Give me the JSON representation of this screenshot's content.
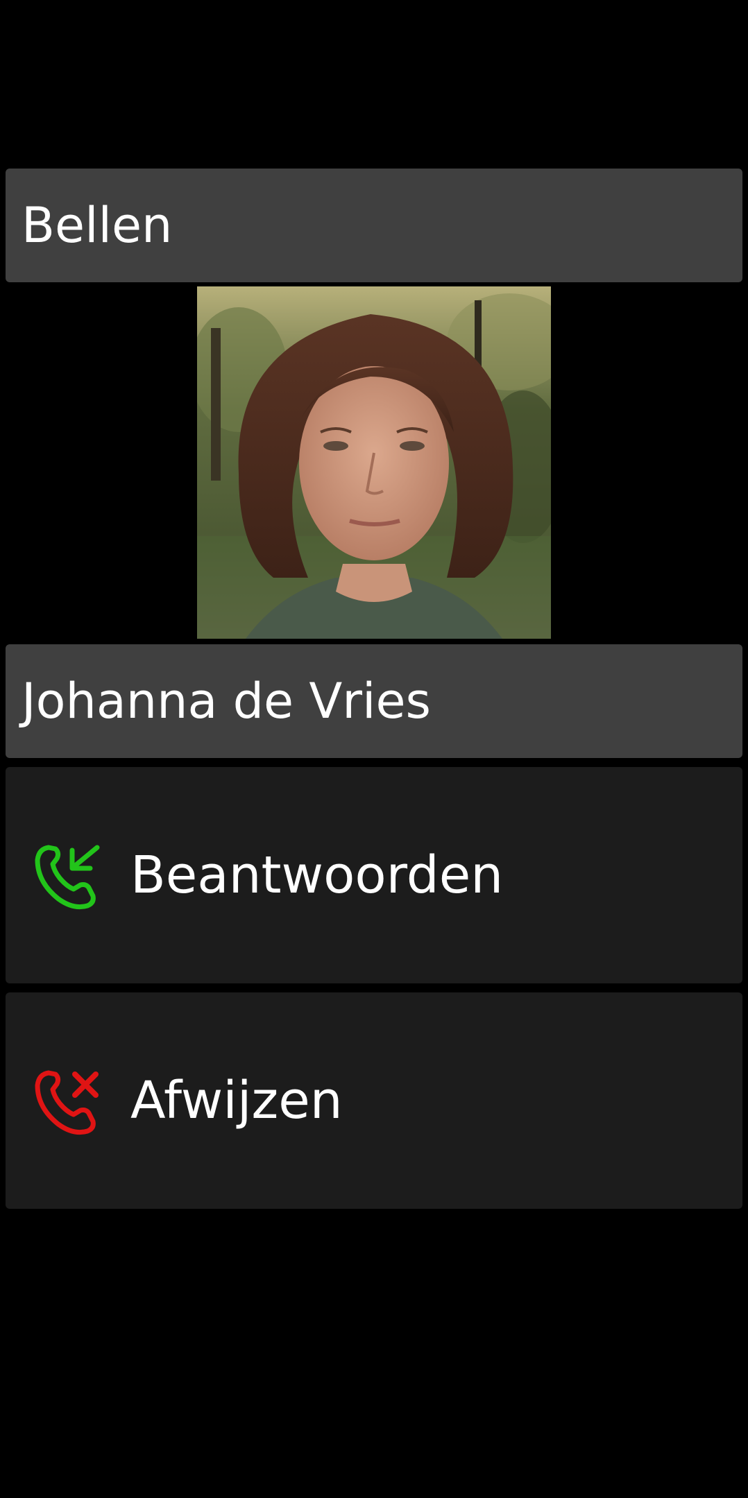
{
  "header": {
    "title": "Bellen"
  },
  "caller": {
    "name": "Johanna de Vries",
    "photo_icon": "contact-photo"
  },
  "actions": {
    "answer": {
      "label": "Beantwoorden",
      "icon": "incoming-call-icon",
      "color": "#22c41a"
    },
    "decline": {
      "label": "Afwijzen",
      "icon": "decline-call-icon",
      "color": "#e01414"
    }
  },
  "theme": {
    "background": "#000000",
    "bar_color": "#404040",
    "button_color": "#1c1c1c",
    "text_color": "#ffffff"
  }
}
